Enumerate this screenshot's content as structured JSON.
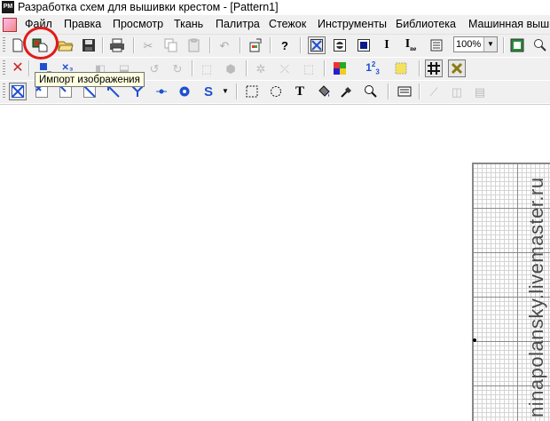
{
  "window": {
    "app_icon_label": "PM",
    "title": "Разработка схем для вышивки крестом - [Pattern1]"
  },
  "menu": [
    {
      "label": "Файл"
    },
    {
      "label": "Правка"
    },
    {
      "label": "Просмотр"
    },
    {
      "label": "Ткань"
    },
    {
      "label": "Палитра"
    },
    {
      "label": "Стежок"
    },
    {
      "label": "Инструменты"
    },
    {
      "label": "Библиотека"
    },
    {
      "label": "Машинная выши"
    }
  ],
  "toolbar": {
    "zoom_value": "100%",
    "text_tool_label": "I",
    "text_tool_label_2": "I",
    "text_tool_label_2_sub": "ne",
    "number_tool_label": "1",
    "number_tool_sup": "2",
    "number_tool_sub": "3",
    "help_label": "?",
    "s_tool_label": "S",
    "t_tool_label": "T"
  },
  "tooltip": {
    "text": "Импорт изображения"
  },
  "watermark": {
    "text": "ninapolansky.livemaster.ru"
  },
  "colors": {
    "highlight_circle": "#e21a1a",
    "tool_blue": "#1f4fd1",
    "tooltip_bg": "#ffffe1"
  }
}
